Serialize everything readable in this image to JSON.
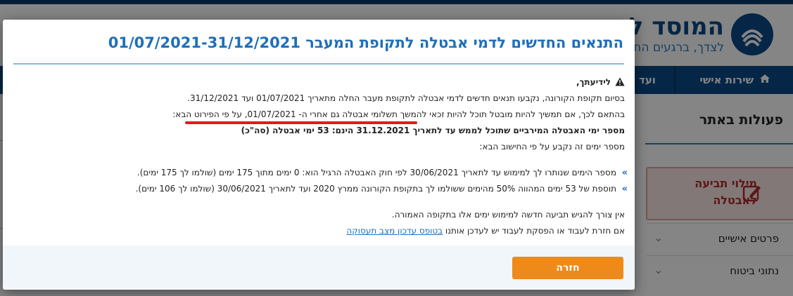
{
  "site": {
    "logo_title": "המוסד לב",
    "logo_subtitle": "לצדך, ברגעים הח",
    "nav": {
      "personal_service": "שירות אישי",
      "more": "ועד"
    },
    "side": {
      "actions_title": "פעולות באתר",
      "claim_label_1": "מילוי תביעה",
      "claim_label_2": "לאבטלה",
      "items": [
        {
          "label": "פרטים אישיים"
        },
        {
          "label": "נתוני ביטוח"
        }
      ]
    }
  },
  "modal": {
    "title": "התנאים החדשים לדמי אבטלה לתקופת המעבר 01/07/2021-31/12/2021",
    "notice_label": "לידיעתך,",
    "para_1": "בסיום תקופת הקורונה, נקבעו תנאים חדשים לדמי אבטלה לתקופת מעבר החלה מתאריך 01/07/2021 ועד 31/12/2021.",
    "para_2_before": "בהתאם לכך, אם תמשיך להיות מובטל תוכל להיות זכאי להמשך תשלומי אבטלה גם אחרי ה- ",
    "para_2_date": "01/07/2021",
    "para_2_after": ", על פי הפירוט הבא:",
    "max_days_line": "מספר ימי האבטלה המירביים שתוכל לממש עד לתאריך 31.12.2021 הינם: 53 ימי אבטלה (סה\"כ)",
    "calc_intro": "מספר ימים זה נקבע על פי החישוב הבא:",
    "bullets": [
      "מספר הימים שנותרו לך למימוש עד לתאריך 30/06/2021 לפי חוק האבטלה הרגיל הוא: 0 ימים מתוך 175 ימים (שולמו לך 175 ימים).",
      "תוספת של 53 ימים המהווה 50% מהימים ששולמו לך בתקופת הקורונה ממרץ 2020 ועד לתאריך 30/06/2021 (שולמו לך 106 ימים)."
    ],
    "no_need_line": "אין צורך להגיש תביעה חדשה למימוש ימים אלו בתקופה האמורה.",
    "return_line_prefix": "אם חזרת לעבוד או הפסקת לעבוד יש לעדכן אותנו ",
    "return_link": "בטופס עדכון מצב תעסוקה",
    "back_button": "חזרה"
  },
  "colors": {
    "brand_blue": "#0b4a86",
    "title_blue": "#1f6fb8",
    "accent_orange": "#ee8a1a",
    "highlight_red": "#e01b1b"
  }
}
